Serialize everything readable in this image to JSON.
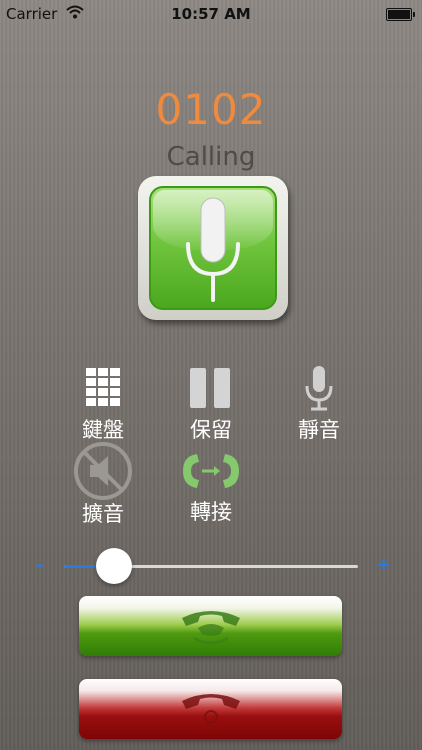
{
  "status_bar": {
    "carrier": "Carrier",
    "time": "10:57 AM",
    "battery_icon": "battery-icon",
    "wifi_icon": "wifi-icon"
  },
  "call": {
    "number": "0102",
    "status": "Calling"
  },
  "controls": [
    {
      "label": "鍵盤",
      "icon": "keypad-icon"
    },
    {
      "label": "保留",
      "icon": "pause-icon"
    },
    {
      "label": "靜音",
      "icon": "mute-mic-icon"
    },
    {
      "label": "擴音",
      "icon": "speaker-off-icon"
    },
    {
      "label": "轉接",
      "icon": "transfer-icon"
    }
  ],
  "volume": {
    "minus": "-",
    "plus": "+",
    "level": 0.17,
    "accent": "#2a7be0"
  },
  "colors": {
    "number": "#f08a3e",
    "answer": "#4f9a10",
    "hangup": "#9a0f0f"
  }
}
